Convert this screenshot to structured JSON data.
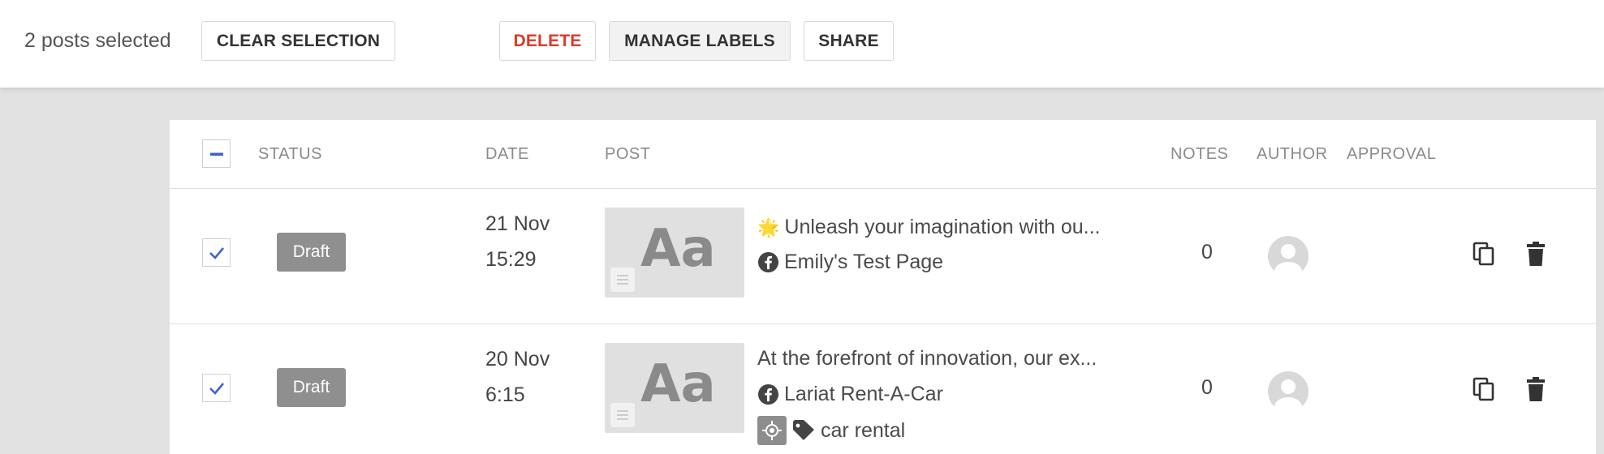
{
  "toolbar": {
    "selection_text": "2 posts selected",
    "clear_label": "CLEAR SELECTION",
    "delete_label": "DELETE",
    "manage_labels_label": "MANAGE LABELS",
    "share_label": "SHARE"
  },
  "table": {
    "columns": {
      "status": "STATUS",
      "date": "DATE",
      "post": "POST",
      "notes": "NOTES",
      "author": "AUTHOR",
      "approval": "APPROVAL"
    },
    "select_all_state": "indeterminate",
    "rows": [
      {
        "selected": true,
        "status": "Draft",
        "date": "21 Nov",
        "time": "15:29",
        "thumb_text": "Aa",
        "emoji": "🌟",
        "text": "Unleash your imagination with ou...",
        "page": "Emily's Test Page",
        "notes": "0"
      },
      {
        "selected": true,
        "status": "Draft",
        "date": "20 Nov",
        "time": "6:15",
        "thumb_text": "Aa",
        "text": "At the forefront of innovation, our ex...",
        "page": "Lariat Rent-A-Car",
        "label": "car rental",
        "notes": "0"
      }
    ]
  },
  "icons": {
    "checkbox": "check-icon",
    "indeterminate": "minus-icon",
    "page": "facebook-icon",
    "copy": "copy-icon",
    "delete": "trash-icon",
    "label": "tag-icon",
    "target": "target-icon",
    "avatar": "user-placeholder-icon"
  },
  "colors": {
    "accent": "#3b63d8",
    "danger": "#d93a2b",
    "badge": "#8f8f8f"
  }
}
